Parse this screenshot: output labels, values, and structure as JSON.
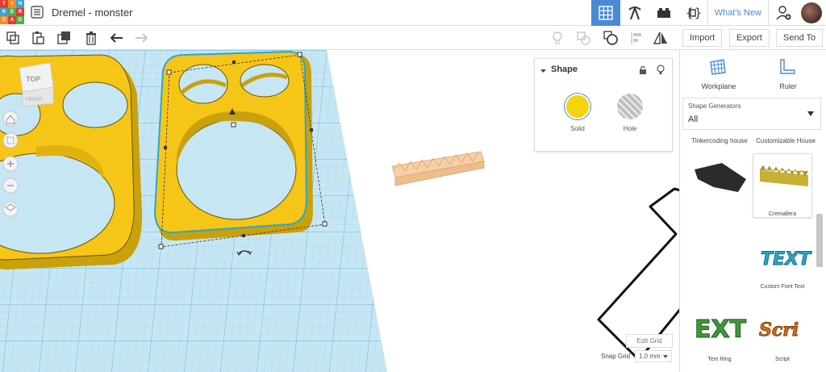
{
  "app": {
    "logo_letters": [
      "TIN",
      "KER",
      "CAD"
    ],
    "title": "Dremel - monster",
    "whats_new": "What's New"
  },
  "toolbar": {
    "import": "Import",
    "export": "Export",
    "send_to": "Send To"
  },
  "viewcube": {
    "top": "TOP",
    "front": "FRONT"
  },
  "shape_panel": {
    "title": "Shape",
    "solid": "Solid",
    "hole": "Hole"
  },
  "sidebar": {
    "workplane": "Workplane",
    "ruler": "Ruler",
    "generators_label": "Shape Generators",
    "generators_value": "All",
    "items": [
      {
        "label": "Tinkercoding house"
      },
      {
        "label": "Customizable House"
      },
      {
        "label": "Cremallera"
      },
      {
        "label": "Custom Font Text"
      },
      {
        "label": "Text Ring"
      },
      {
        "label": "Script"
      }
    ]
  },
  "grid": {
    "edit": "Edit Grid",
    "snap_label": "Snap Grid",
    "snap_value": "1.0 mm"
  },
  "colors": {
    "accent": "#4a8ad4",
    "shape_yellow": "#f5c518",
    "grid_blue": "#bfe1f2"
  }
}
